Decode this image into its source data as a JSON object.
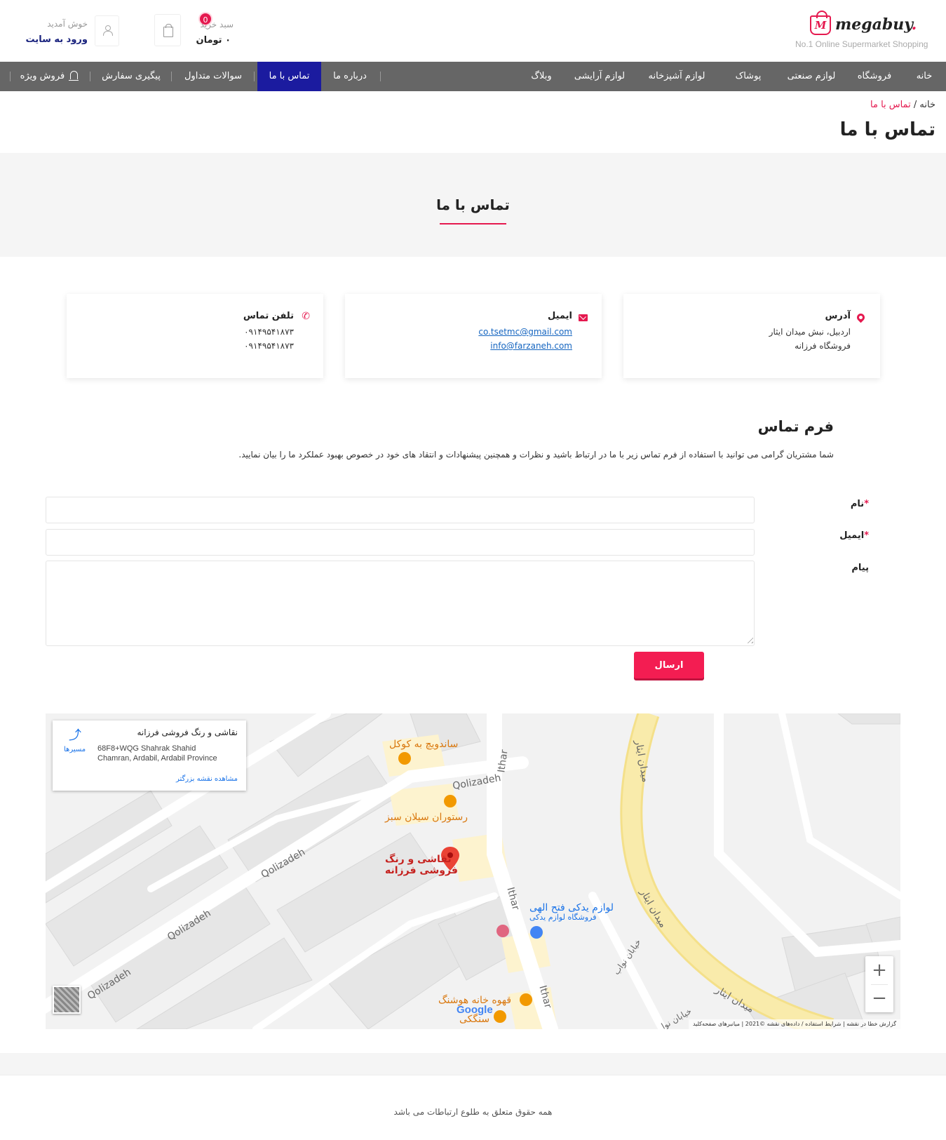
{
  "header": {
    "logo_text": "megabuy",
    "logo_dot": ".",
    "logo_letter": "M",
    "logo_tagline": "No.1 Online Supermarket Shopping",
    "cart_label": "سبد خرید",
    "cart_total": "۰ تومان",
    "cart_count": "0",
    "welcome": "خوش آمدید",
    "login": "ورود به سایت"
  },
  "nav": {
    "items": [
      "خانه",
      "فروشگاه",
      "لوازم صنعتی",
      "پوشاک",
      "لوازم آشپزخانه",
      "لوازم آرایشی",
      "وبلاگ"
    ],
    "left_items": [
      "درباره ما",
      "تماس با ما",
      "سوالات متداول",
      "پیگیری سفارش",
      "فروش ویژه"
    ]
  },
  "breadcrumb": {
    "home": "خانه",
    "sep": " / ",
    "current": "تماس با ما"
  },
  "page_title": "تماس با ما",
  "section_title": "تماس با ما",
  "cards": {
    "address": {
      "title": "آدرس",
      "line1": "اردبیل، نبش میدان ایثار",
      "line2": "فروشگاه فرزانه"
    },
    "email": {
      "title": "ایمیل",
      "line1": "co.tsetmc@gmail.com",
      "line2": "info@farzaneh.com"
    },
    "phone": {
      "title": "تلفن تماس",
      "line1": "۰۹۱۴۹۵۴۱۸۷۳",
      "line2": "۰۹۱۴۹۵۴۱۸۷۳"
    }
  },
  "form": {
    "title": "فرم تماس",
    "description": "شما مشتریان گرامی می توانید با استفاده از فرم تماس زیر با ما در ارتباط باشید و نظرات و همچنین پیشنهادات و انتقاد های خود در خصوص بهبود عملکرد ما را بیان نمایید.",
    "name_label": "نام",
    "email_label": "ایمیل",
    "message_label": "پیام",
    "required_mark": "*",
    "submit": "ارسال"
  },
  "map": {
    "card_title": "نقاشی و رنگ فروشی فرزانه",
    "card_addr1": "68F8+WQG Shahrak Shahid",
    "card_addr2": "Chamran, Ardabil, Ardabil Province",
    "card_link": "مشاهده نقشه بزرگتر",
    "card_directions": "مسیرها",
    "labels": {
      "sandwich": "ساندویچ به کوکل",
      "restaurant": "رستوران سیلان سبز",
      "shop_line1": "نقاشی و رنگ",
      "shop_line2": "فروشی فرزانه",
      "parts_line1": "لوازم یدکی فتح الهی",
      "parts_line2": "فروشگاه لوازم یدکی",
      "cafe": "قهوه خانه هوشنگ",
      "sangaki": "سنگکی",
      "square_top": "میدان ایثار",
      "square_mid": "میدان ایثار",
      "square_bottom": "میدان ایثار",
      "street1": "خیابان نواب",
      "street2": "خیابان نوا",
      "qolizadeh": "Qolizadeh",
      "ithar": "Ithar"
    },
    "zoom_in": "+",
    "zoom_out": "−",
    "google": "Google",
    "footer": "گزارش خطا در نقشه  |  شرایط استفاده  /  داده‌های نقشه ©2021  |  میانبرهای صفحه‌کلید"
  },
  "footer": {
    "copyright": "همه حقوق متعلق به طلوع ارتباطات می باشد"
  },
  "colors": {
    "accent": "#e5194f",
    "nav_bg": "#666666",
    "nav_active": "#1b1b9f",
    "button": "#f31d52"
  }
}
